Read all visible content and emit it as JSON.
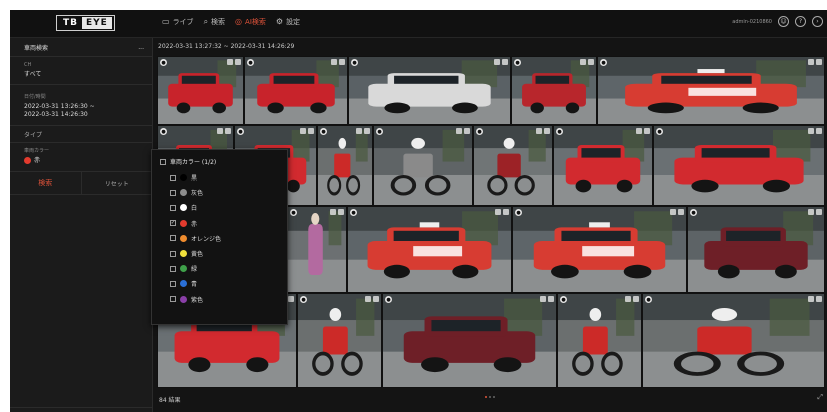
{
  "logo": {
    "left": "TB",
    "right": "EYE"
  },
  "nav": [
    {
      "icon": "monitor-icon",
      "label": "ライブ"
    },
    {
      "icon": "search-icon",
      "label": "検索"
    },
    {
      "icon": "ai-search-icon",
      "label": "AI検索"
    },
    {
      "icon": "settings-icon",
      "label": "設定"
    }
  ],
  "topright": {
    "user": "admin-0210860"
  },
  "sidebar": {
    "title": "車両検索",
    "more": "...",
    "ch_label": "CH",
    "ch_value": "すべて",
    "datetime_label": "日付/時間",
    "datetime_start": "2022-03-31 13:26:30 ~",
    "datetime_end": "2022-03-31 14:26:30",
    "type_label": "タイプ",
    "color_label": "車両カラー",
    "color_value": "赤",
    "color_value_hex": "#e33b2e",
    "search_button": "検索",
    "reset_button": "リセット"
  },
  "results": {
    "range": "2022-03-31 13:27:32 ~ 2022-03-31 14:26:29",
    "count": "84 結果",
    "expand_icon": "expand-icon"
  },
  "dropdown": {
    "title": "車両カラー (1/2)",
    "options": [
      {
        "label": "黒",
        "color": "#000000",
        "checked": false
      },
      {
        "label": "灰色",
        "color": "#8c8c8c",
        "checked": false
      },
      {
        "label": "白",
        "color": "#ffffff",
        "checked": false
      },
      {
        "label": "赤",
        "color": "#e33b2e",
        "checked": true
      },
      {
        "label": "オレンジ色",
        "color": "#f08c2e",
        "checked": false
      },
      {
        "label": "黄色",
        "color": "#f0e03c",
        "checked": false
      },
      {
        "label": "緑",
        "color": "#3fa14a",
        "checked": false
      },
      {
        "label": "青",
        "color": "#2a6fd6",
        "checked": false
      },
      {
        "label": "紫色",
        "color": "#8a3fa8",
        "checked": false
      }
    ]
  },
  "thumbnails": [
    {
      "vehicle": "red-compact-car"
    },
    {
      "vehicle": "red-compact-car"
    },
    {
      "vehicle": "truck-street"
    },
    {
      "vehicle": "red-truck"
    },
    {
      "vehicle": "red-taxi"
    },
    {
      "vehicle": "red-car"
    },
    {
      "vehicle": "red-car"
    },
    {
      "vehicle": "scooter"
    },
    {
      "vehicle": "bicycles"
    },
    {
      "vehicle": "bicycle"
    },
    {
      "vehicle": "red-car"
    },
    {
      "vehicle": "red-car"
    },
    {
      "vehicle": "red-car"
    },
    {
      "vehicle": "pedestrian"
    },
    {
      "vehicle": "red-taxi"
    },
    {
      "vehicle": "red-taxi"
    },
    {
      "vehicle": "dark-red-van"
    },
    {
      "vehicle": "red-car"
    },
    {
      "vehicle": "scooter"
    },
    {
      "vehicle": "dark-red-van"
    },
    {
      "vehicle": "scooter"
    },
    {
      "vehicle": "scooter"
    }
  ]
}
